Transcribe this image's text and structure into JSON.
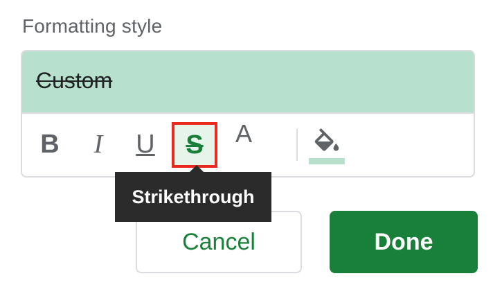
{
  "section": {
    "label": "Formatting style"
  },
  "preview": {
    "text": "Custom",
    "background": "#b7e1cd"
  },
  "toolbar": {
    "bold_label": "B",
    "italic_label": "I",
    "underline_label": "U",
    "strikethrough_label": "S",
    "text_color_label": "A",
    "fill_color": "#b7e1cd",
    "selected_tool": "strikethrough"
  },
  "tooltip": {
    "text": "Strikethrough"
  },
  "buttons": {
    "cancel": "Cancel",
    "done": "Done"
  },
  "colors": {
    "accent": "#188038",
    "highlight_outline": "#ea2a1d",
    "tooltip_bg": "#2a2a2a"
  }
}
